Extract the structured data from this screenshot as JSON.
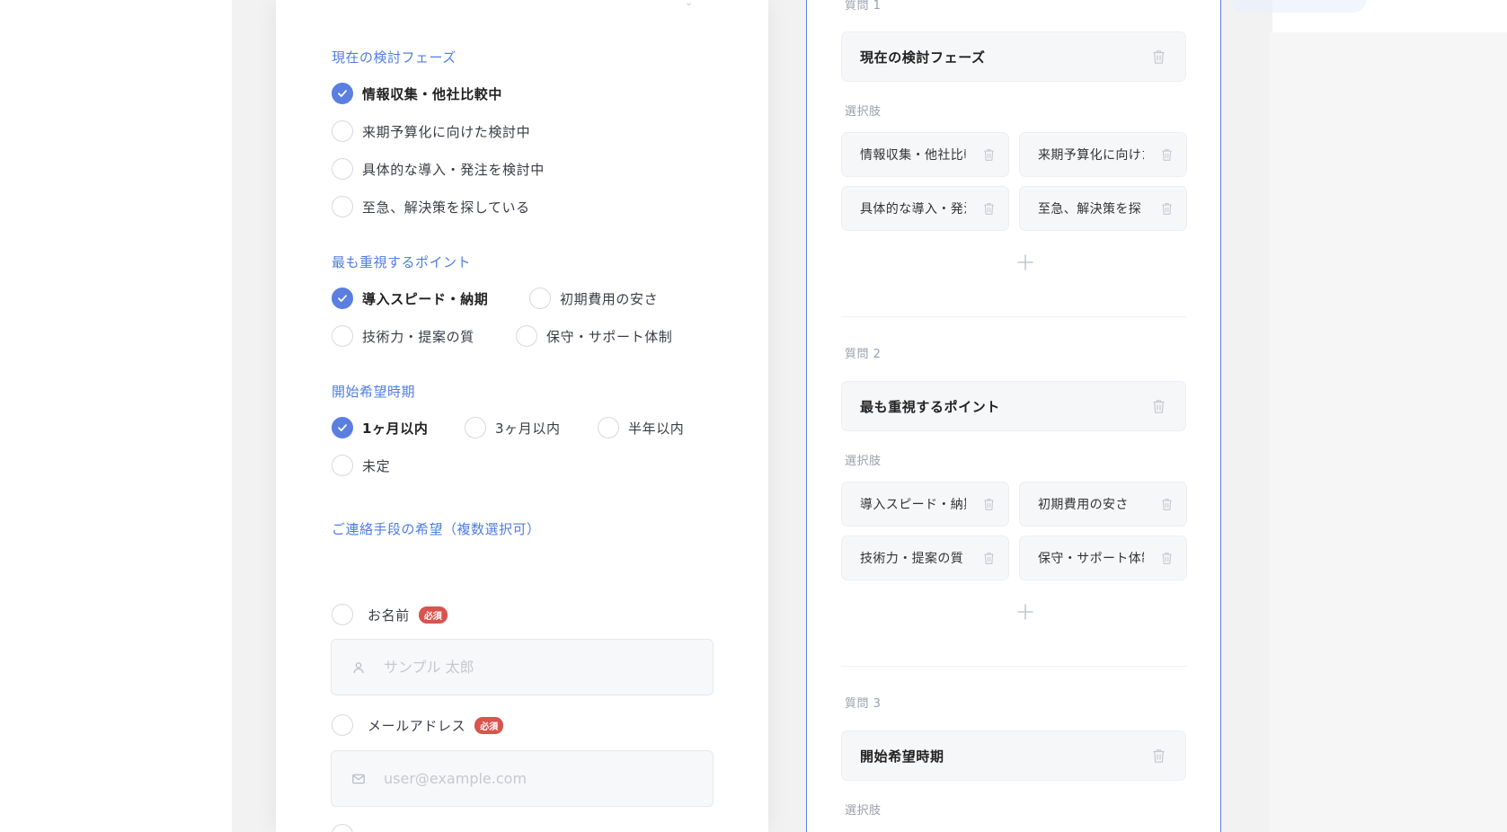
{
  "preview": {
    "sections": [
      {
        "title": "現在の検討フェーズ",
        "options": [
          {
            "label": "情報収集・他社比較中",
            "checked": true
          },
          {
            "label": "来期予算化に向けた検討中",
            "checked": false
          },
          {
            "label": "具体的な導入・発注を検討中",
            "checked": false
          },
          {
            "label": "至急、解決策を探している",
            "checked": false
          }
        ]
      },
      {
        "title": "最も重視するポイント",
        "options": [
          {
            "label": "導入スピード・納期",
            "checked": true
          },
          {
            "label": "初期費用の安さ",
            "checked": false
          },
          {
            "label": "技術力・提案の質",
            "checked": false
          },
          {
            "label": "保守・サポート体制",
            "checked": false
          }
        ]
      },
      {
        "title": "開始希望時期",
        "options": [
          {
            "label": "1ヶ月以内",
            "checked": true
          },
          {
            "label": "3ヶ月以内",
            "checked": false
          },
          {
            "label": "半年以内",
            "checked": false
          },
          {
            "label": "未定",
            "checked": false
          }
        ]
      },
      {
        "title": "ご連絡手段の希望（複数選択可）"
      }
    ],
    "contact": {
      "name_label": "お名前",
      "name_required": "必須",
      "name_placeholder": "サンプル 太郎",
      "email_label": "メールアドレス",
      "email_required": "必須",
      "email_placeholder": "user@example.com"
    }
  },
  "editor": {
    "choices_label": "選択肢",
    "questions": [
      {
        "label": "質問 1",
        "title": "現在の検討フェーズ",
        "choices": [
          "情報収集・他社比較中",
          "来期予算化に向けた検討中",
          "具体的な導入・発注を検討中",
          "至急、解決策を探している"
        ]
      },
      {
        "label": "質問 2",
        "title": "最も重視するポイント",
        "choices": [
          "導入スピード・納期",
          "初期費用の安さ",
          "技術力・提案の質",
          "保守・サポート体制"
        ]
      },
      {
        "label": "質問 3",
        "title": "開始希望時期"
      }
    ]
  },
  "colors": {
    "accent": "#5b7fe0",
    "section_title": "#4f7de3",
    "required_badge": "#d9534f"
  },
  "icons": {
    "check": "check-icon",
    "trash": "trash-icon",
    "plus": "plus-icon",
    "person": "person-icon",
    "mail": "mail-icon"
  }
}
